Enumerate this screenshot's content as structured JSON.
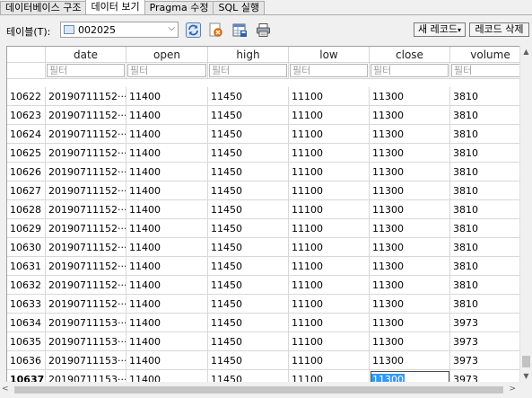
{
  "tabs": [
    {
      "label": "데이터베이스 구조"
    },
    {
      "label": "데이터 보기"
    },
    {
      "label": "Pragma 수정"
    },
    {
      "label": "SQL 실행"
    }
  ],
  "toolbar": {
    "table_label": "테이블(T):",
    "table_value": "002025",
    "new_record_label": "새 레코드",
    "delete_record_label": "레코드 삭제"
  },
  "grid": {
    "columns": [
      "date",
      "open",
      "high",
      "low",
      "close",
      "volume"
    ],
    "filter_placeholder": "필터",
    "rows": [
      {
        "rownum": "10622",
        "date": "20190711152···",
        "open": "11400",
        "high": "11450",
        "low": "11100",
        "close": "11300",
        "volume": "3810"
      },
      {
        "rownum": "10623",
        "date": "20190711152···",
        "open": "11400",
        "high": "11450",
        "low": "11100",
        "close": "11300",
        "volume": "3810"
      },
      {
        "rownum": "10624",
        "date": "20190711152···",
        "open": "11400",
        "high": "11450",
        "low": "11100",
        "close": "11300",
        "volume": "3810"
      },
      {
        "rownum": "10625",
        "date": "20190711152···",
        "open": "11400",
        "high": "11450",
        "low": "11100",
        "close": "11300",
        "volume": "3810"
      },
      {
        "rownum": "10626",
        "date": "20190711152···",
        "open": "11400",
        "high": "11450",
        "low": "11100",
        "close": "11300",
        "volume": "3810"
      },
      {
        "rownum": "10627",
        "date": "20190711152···",
        "open": "11400",
        "high": "11450",
        "low": "11100",
        "close": "11300",
        "volume": "3810"
      },
      {
        "rownum": "10628",
        "date": "20190711152···",
        "open": "11400",
        "high": "11450",
        "low": "11100",
        "close": "11300",
        "volume": "3810"
      },
      {
        "rownum": "10629",
        "date": "20190711152···",
        "open": "11400",
        "high": "11450",
        "low": "11100",
        "close": "11300",
        "volume": "3810"
      },
      {
        "rownum": "10630",
        "date": "20190711152···",
        "open": "11400",
        "high": "11450",
        "low": "11100",
        "close": "11300",
        "volume": "3810"
      },
      {
        "rownum": "10631",
        "date": "20190711152···",
        "open": "11400",
        "high": "11450",
        "low": "11100",
        "close": "11300",
        "volume": "3810"
      },
      {
        "rownum": "10632",
        "date": "20190711152···",
        "open": "11400",
        "high": "11450",
        "low": "11100",
        "close": "11300",
        "volume": "3810"
      },
      {
        "rownum": "10633",
        "date": "20190711152···",
        "open": "11400",
        "high": "11450",
        "low": "11100",
        "close": "11300",
        "volume": "3810"
      },
      {
        "rownum": "10634",
        "date": "20190711153···",
        "open": "11400",
        "high": "11450",
        "low": "11100",
        "close": "11300",
        "volume": "3973"
      },
      {
        "rownum": "10635",
        "date": "20190711153···",
        "open": "11400",
        "high": "11450",
        "low": "11100",
        "close": "11300",
        "volume": "3973"
      },
      {
        "rownum": "10636",
        "date": "20190711153···",
        "open": "11400",
        "high": "11450",
        "low": "11100",
        "close": "11300",
        "volume": "3973"
      },
      {
        "rownum": "10637",
        "date": "20190711153···",
        "open": "11400",
        "high": "11450",
        "low": "11100",
        "close": "11300",
        "volume": "3973",
        "current": true,
        "selected_column": "close"
      }
    ]
  },
  "icons": {
    "table_icon": "table-icon",
    "refresh": "refresh-icon",
    "clear_filters": "clear-filter-icon",
    "save_table": "save-table-icon",
    "print": "print-icon"
  },
  "colors": {
    "selection": "#3399ff",
    "background": "#f0f0f0"
  }
}
